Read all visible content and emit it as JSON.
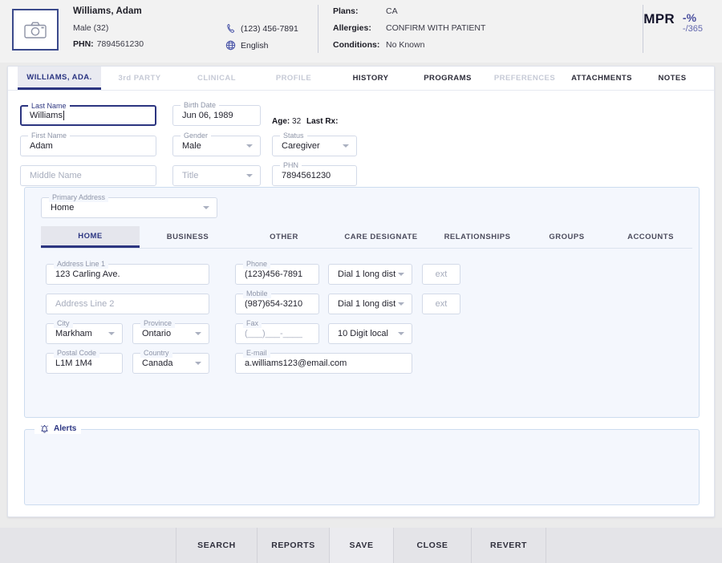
{
  "header": {
    "photo_icon": "camera-icon",
    "patient_name": "Williams, Adam",
    "gender_age": "Male (32)",
    "phn_label": "PHN:",
    "phn_value": "7894561230",
    "phone_icon": "phone-handset-icon",
    "phone": "(123) 456-7891",
    "language_icon": "globe-icon",
    "language": "English",
    "clinical": [
      {
        "label": "Plans:",
        "value": "CA"
      },
      {
        "label": "Allergies:",
        "value": "CONFIRM WITH PATIENT"
      },
      {
        "label": "Conditions:",
        "value": "No Known"
      }
    ],
    "mpr": {
      "label": "MPR",
      "percent": "-%",
      "denominator": "-/365"
    }
  },
  "tabs": [
    {
      "label": "WILLIAMS, ADA.",
      "state": "active"
    },
    {
      "label": "3rd PARTY",
      "state": "disabled"
    },
    {
      "label": "CLINICAL",
      "state": "disabled"
    },
    {
      "label": "PROFILE",
      "state": "disabled"
    },
    {
      "label": "HISTORY",
      "state": "enabled"
    },
    {
      "label": "PROGRAMS",
      "state": "enabled"
    },
    {
      "label": "PREFERENCES",
      "state": "disabled"
    },
    {
      "label": "ATTACHMENTS",
      "state": "enabled"
    },
    {
      "label": "NOTES",
      "state": "enabled"
    }
  ],
  "demographics": {
    "last_name": {
      "label": "Last Name",
      "value": "Williams",
      "focused": true
    },
    "birth_date": {
      "label": "Birth Date",
      "value": "Jun 06, 1989"
    },
    "age_label": "Age:",
    "age_value": "32",
    "last_rx_label": "Last Rx:",
    "last_rx_value": "",
    "first_name": {
      "label": "First Name",
      "value": "Adam"
    },
    "gender": {
      "label": "Gender",
      "value": "Male"
    },
    "status": {
      "label": "Status",
      "value": "Caregiver"
    },
    "middle_name": {
      "label": "",
      "placeholder": "Middle Name"
    },
    "title": {
      "label": "",
      "placeholder": "Title"
    },
    "phn": {
      "label": "PHN",
      "value": "7894561230"
    }
  },
  "address": {
    "primary_address": {
      "label": "Primary Address",
      "value": "Home"
    },
    "subtabs": [
      {
        "label": "HOME",
        "state": "active"
      },
      {
        "label": "BUSINESS",
        "state": "enabled"
      },
      {
        "label": "OTHER",
        "state": "enabled"
      },
      {
        "label": "CARE DESIGNATE",
        "state": "enabled"
      },
      {
        "label": "RELATIONSHIPS",
        "state": "enabled"
      },
      {
        "label": "GROUPS",
        "state": "enabled"
      },
      {
        "label": "ACCOUNTS",
        "state": "enabled"
      }
    ],
    "line1": {
      "label": "Address Line 1",
      "value": "123 Carling Ave."
    },
    "line2": {
      "label": "",
      "placeholder": "Address Line 2"
    },
    "city": {
      "label": "City",
      "value": "Markham"
    },
    "province": {
      "label": "Province",
      "value": "Ontario"
    },
    "postal_code": {
      "label": "Postal Code",
      "value": "L1M 1M4"
    },
    "country": {
      "label": "Country",
      "value": "Canada"
    },
    "phone": {
      "label": "Phone",
      "value": "(123)456-7891"
    },
    "phone_dial": {
      "label": "",
      "value": "Dial 1 long dist"
    },
    "phone_ext": {
      "label": "",
      "placeholder": "ext"
    },
    "mobile": {
      "label": "Mobile",
      "value": "(987)654-3210"
    },
    "mobile_dial": {
      "label": "",
      "value": "Dial 1 long dist"
    },
    "mobile_ext": {
      "label": "",
      "placeholder": "ext"
    },
    "fax": {
      "label": "Fax",
      "placeholder": "(___)___-____"
    },
    "fax_dial": {
      "label": "",
      "value": "10 Digit local"
    },
    "email": {
      "label": "E-mail",
      "value": "a.williams123@email.com"
    }
  },
  "alerts": {
    "icon": "bell-icon",
    "title": "Alerts",
    "content": ""
  },
  "toolbar": {
    "buttons": [
      {
        "label": "SEARCH",
        "highlight": false
      },
      {
        "label": "REPORTS",
        "highlight": false
      },
      {
        "label": "SAVE",
        "highlight": true
      },
      {
        "label": "CLOSE",
        "highlight": false
      },
      {
        "label": "REVERT",
        "highlight": false
      }
    ]
  },
  "colors": {
    "accent": "#2c3580",
    "panel_bg": "#f4f7fd",
    "panel_border": "#ccdcef",
    "field_border": "#d3dae8",
    "page_bg": "#ebebeb"
  }
}
